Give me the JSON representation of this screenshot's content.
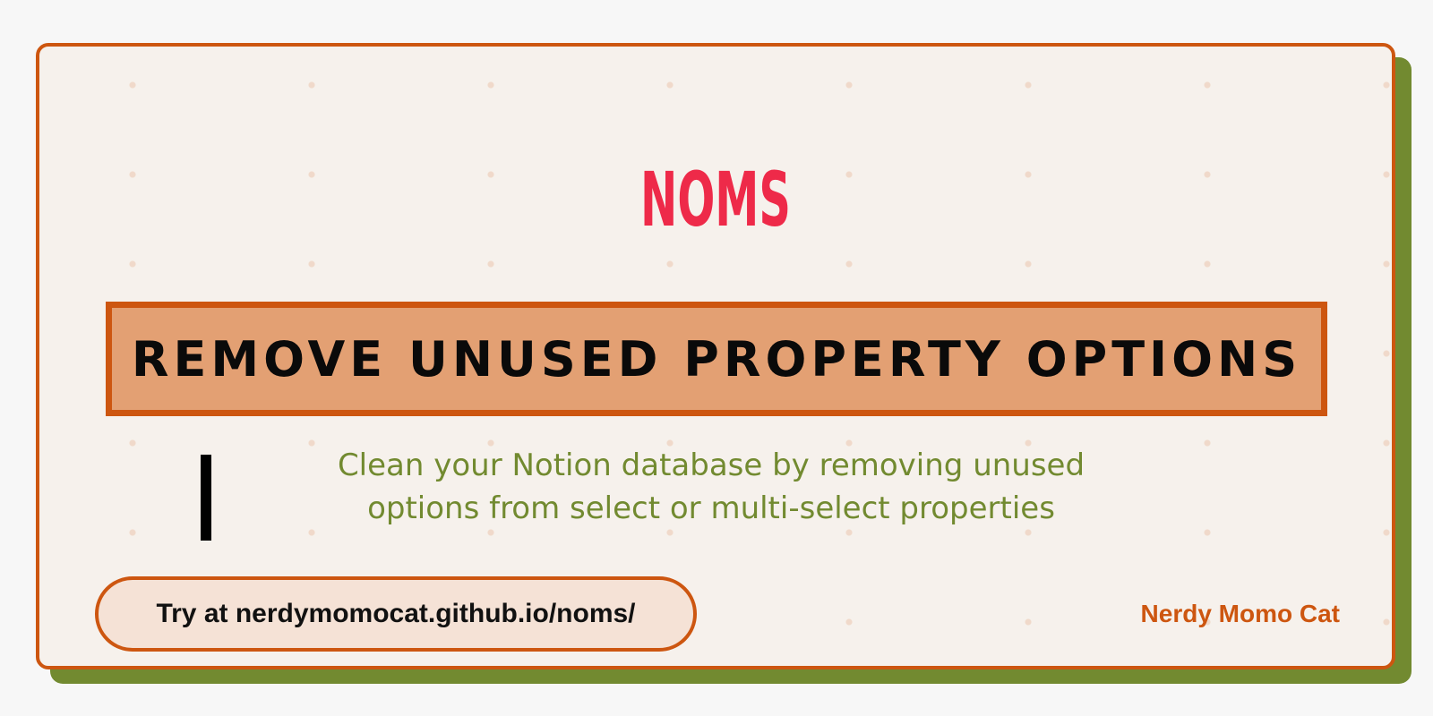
{
  "logo": {
    "text": "NOMS",
    "color": "#ee2a49"
  },
  "title": "REMOVE UNUSED PROPERTY OPTIONS",
  "subtitle": {
    "line1": "Clean your Notion database by removing unused",
    "line2": "options from select or multi-select properties"
  },
  "cta": "Try at nerdymomocat.github.io/noms/",
  "author": "Nerdy Momo Cat",
  "colors": {
    "accent": "#cd5610",
    "title_fill": "#e3a073",
    "card_bg": "#f6f1ec",
    "shadow": "#728a30",
    "subtitle": "#728a30",
    "logo": "#ee2a49"
  }
}
